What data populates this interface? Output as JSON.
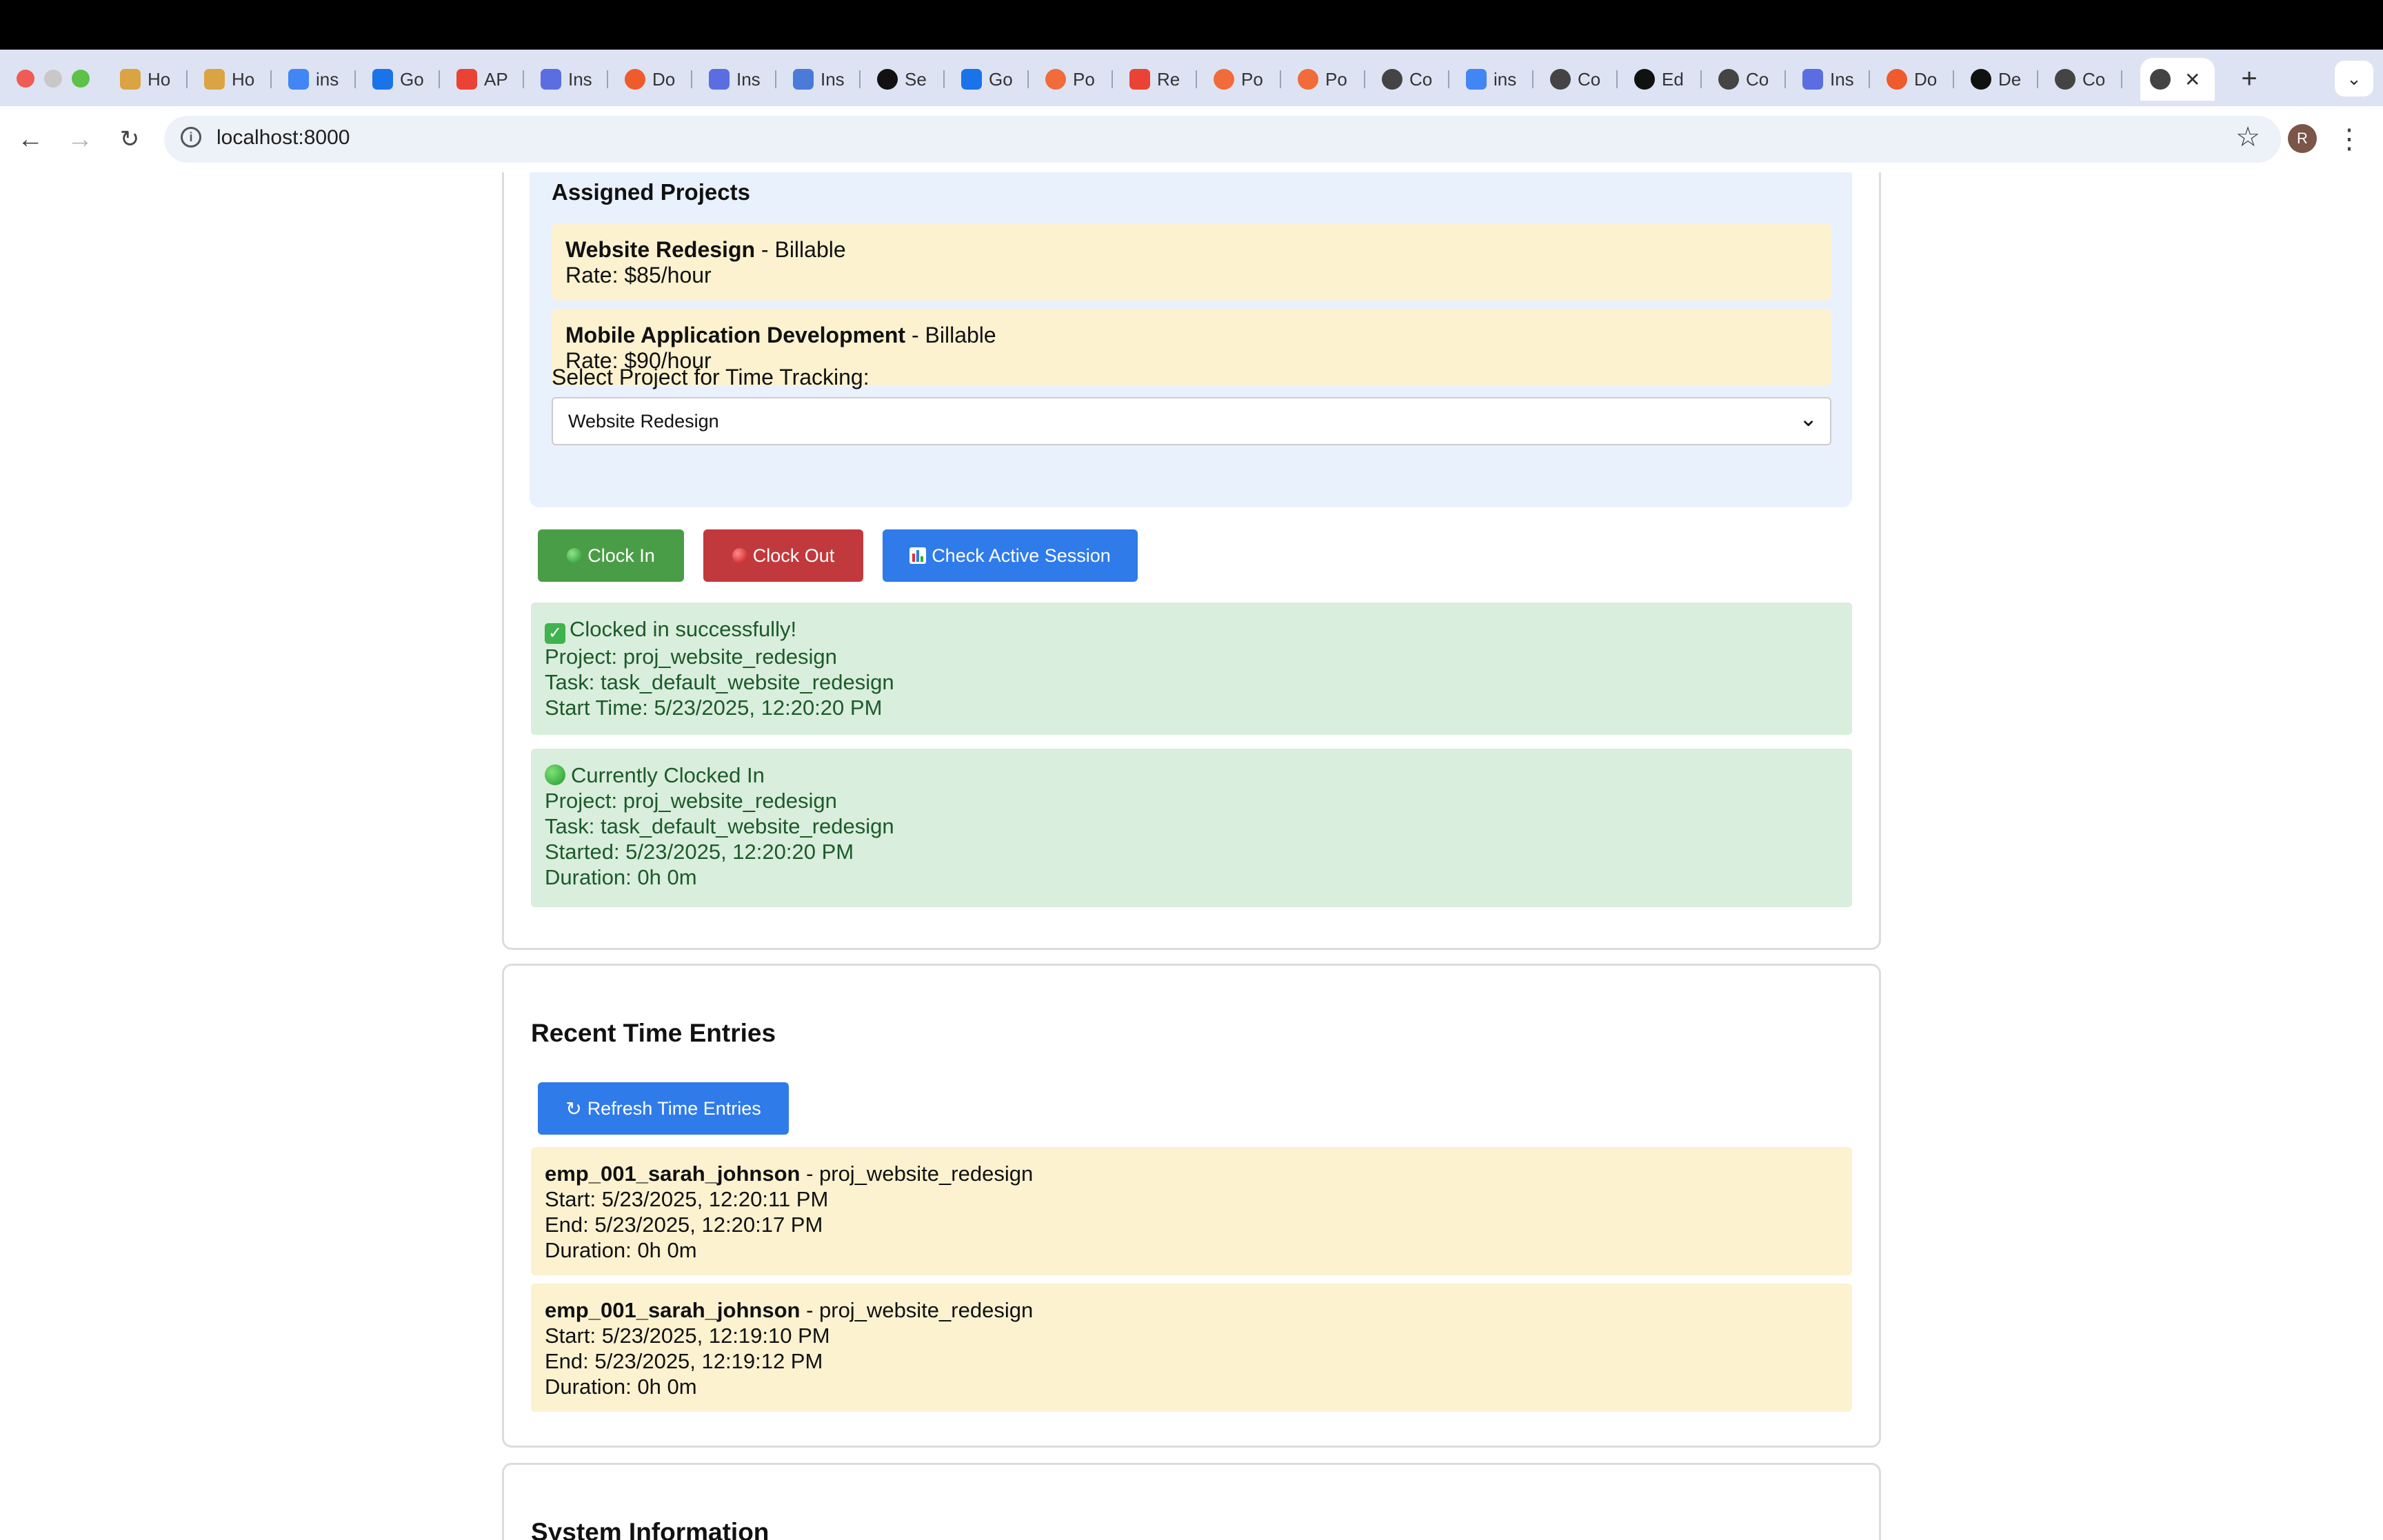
{
  "browser": {
    "tabs": [
      {
        "icon": "notebook-icon",
        "label": "Ho",
        "color": "#d9a441"
      },
      {
        "icon": "notebook-icon",
        "label": "Ho",
        "color": "#d9a441"
      },
      {
        "icon": "google-icon",
        "label": "ins",
        "color": "#4285f4"
      },
      {
        "icon": "calendar-icon",
        "label": "Go",
        "color": "#1a73e8"
      },
      {
        "icon": "gmail-icon",
        "label": "AP",
        "color": "#ea4335"
      },
      {
        "icon": "waveform-icon",
        "label": "Ins",
        "color": "#5b6ee1"
      },
      {
        "icon": "orange-circle-icon",
        "label": "Do",
        "color": "#ef5b2c"
      },
      {
        "icon": "waveform-icon",
        "label": "Ins",
        "color": "#5b6ee1"
      },
      {
        "icon": "docs-icon",
        "label": "Ins",
        "color": "#4a7bd9"
      },
      {
        "icon": "openai-icon",
        "label": "Se",
        "color": "#111111"
      },
      {
        "icon": "calendar-icon",
        "label": "Go",
        "color": "#1a73e8"
      },
      {
        "icon": "postman-icon",
        "label": "Po",
        "color": "#f26b3a"
      },
      {
        "icon": "gmail-icon",
        "label": "Re",
        "color": "#ea4335"
      },
      {
        "icon": "postman-icon",
        "label": "Po",
        "color": "#f26b3a"
      },
      {
        "icon": "postman-icon",
        "label": "Po",
        "color": "#f26b3a"
      },
      {
        "icon": "globe-icon",
        "label": "Co",
        "color": "#444444"
      },
      {
        "icon": "google-icon",
        "label": "ins",
        "color": "#4285f4"
      },
      {
        "icon": "globe-icon",
        "label": "Co",
        "color": "#444444"
      },
      {
        "icon": "github-icon",
        "label": "Ed",
        "color": "#111111"
      },
      {
        "icon": "globe-icon",
        "label": "Co",
        "color": "#444444"
      },
      {
        "icon": "waveform-icon",
        "label": "Ins",
        "color": "#5b6ee1"
      },
      {
        "icon": "orange-circle-icon",
        "label": "Do",
        "color": "#ef5b2c"
      },
      {
        "icon": "github-icon",
        "label": "De",
        "color": "#111111"
      },
      {
        "icon": "globe-icon",
        "label": "Co",
        "color": "#444444"
      }
    ],
    "active_tab": {
      "icon": "globe-icon",
      "close": "✕"
    },
    "new_tab": "+",
    "url": "localhost:8000"
  },
  "assigned": {
    "heading": "Assigned Projects",
    "projects": [
      {
        "name": "Website Redesign",
        "type": " - Billable",
        "rate": "Rate: $85/hour"
      },
      {
        "name": "Mobile Application Development",
        "type": " - Billable",
        "rate": "Rate: $90/hour"
      }
    ],
    "select_label": "Select Project for Time Tracking:",
    "select_value": "Website Redesign"
  },
  "actions": {
    "clock_in": "Clock In",
    "clock_out": "Clock Out",
    "check_session": "Check Active Session"
  },
  "clockin_alert": {
    "title": "Clocked in successfully!",
    "project": "Project: proj_website_redesign",
    "task": "Task: task_default_website_redesign",
    "start": "Start Time: 5/23/2025, 12:20:20 PM"
  },
  "session_alert": {
    "title": "Currently Clocked In",
    "project": "Project: proj_website_redesign",
    "task": "Task: task_default_website_redesign",
    "started": "Started: 5/23/2025, 12:20:20 PM",
    "duration": "Duration: 0h 0m"
  },
  "recent": {
    "heading": "Recent Time Entries",
    "refresh": "Refresh Time Entries",
    "entries": [
      {
        "employee": "emp_001_sarah_johnson",
        "project": " - proj_website_redesign",
        "start": "Start: 5/23/2025, 12:20:11 PM",
        "end": "End: 5/23/2025, 12:20:17 PM",
        "duration": "Duration: 0h 0m"
      },
      {
        "employee": "emp_001_sarah_johnson",
        "project": " - proj_website_redesign",
        "start": "Start: 5/23/2025, 12:19:10 PM",
        "end": "End: 5/23/2025, 12:19:12 PM",
        "duration": "Duration: 0h 0m"
      }
    ]
  },
  "system": {
    "heading": "System Information"
  },
  "colors": {
    "green": "#4a9d47",
    "red": "#c2393d",
    "blue": "#2f7bea",
    "alert_green": "#d9eedc",
    "entry_yellow": "#fcf2d0",
    "panel_blue": "#e8f1fc"
  }
}
